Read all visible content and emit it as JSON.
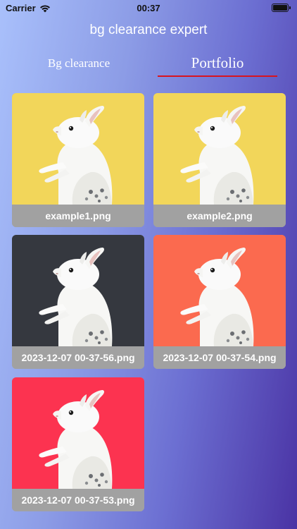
{
  "status_bar": {
    "carrier": "Carrier",
    "time": "00:37"
  },
  "app": {
    "title": "bg clearance expert"
  },
  "tabs": [
    {
      "label": "Bg clearance",
      "selected": false
    },
    {
      "label": "Portfolio",
      "selected": true
    }
  ],
  "colors": {
    "tab_underline": "#d8141f"
  },
  "portfolio": {
    "items": [
      {
        "filename": "example1.png",
        "bg_color": "#f2d65a",
        "icon": "rabbit-image"
      },
      {
        "filename": "example2.png",
        "bg_color": "#f2d65a",
        "icon": "rabbit-image"
      },
      {
        "filename": "2023-12-07 00-37-56.png",
        "bg_color": "#35383f",
        "icon": "rabbit-image"
      },
      {
        "filename": "2023-12-07 00-37-54.png",
        "bg_color": "#fb6a4f",
        "icon": "rabbit-image"
      },
      {
        "filename": "2023-12-07 00-37-53.png",
        "bg_color": "#fc3350",
        "icon": "rabbit-image"
      }
    ]
  }
}
